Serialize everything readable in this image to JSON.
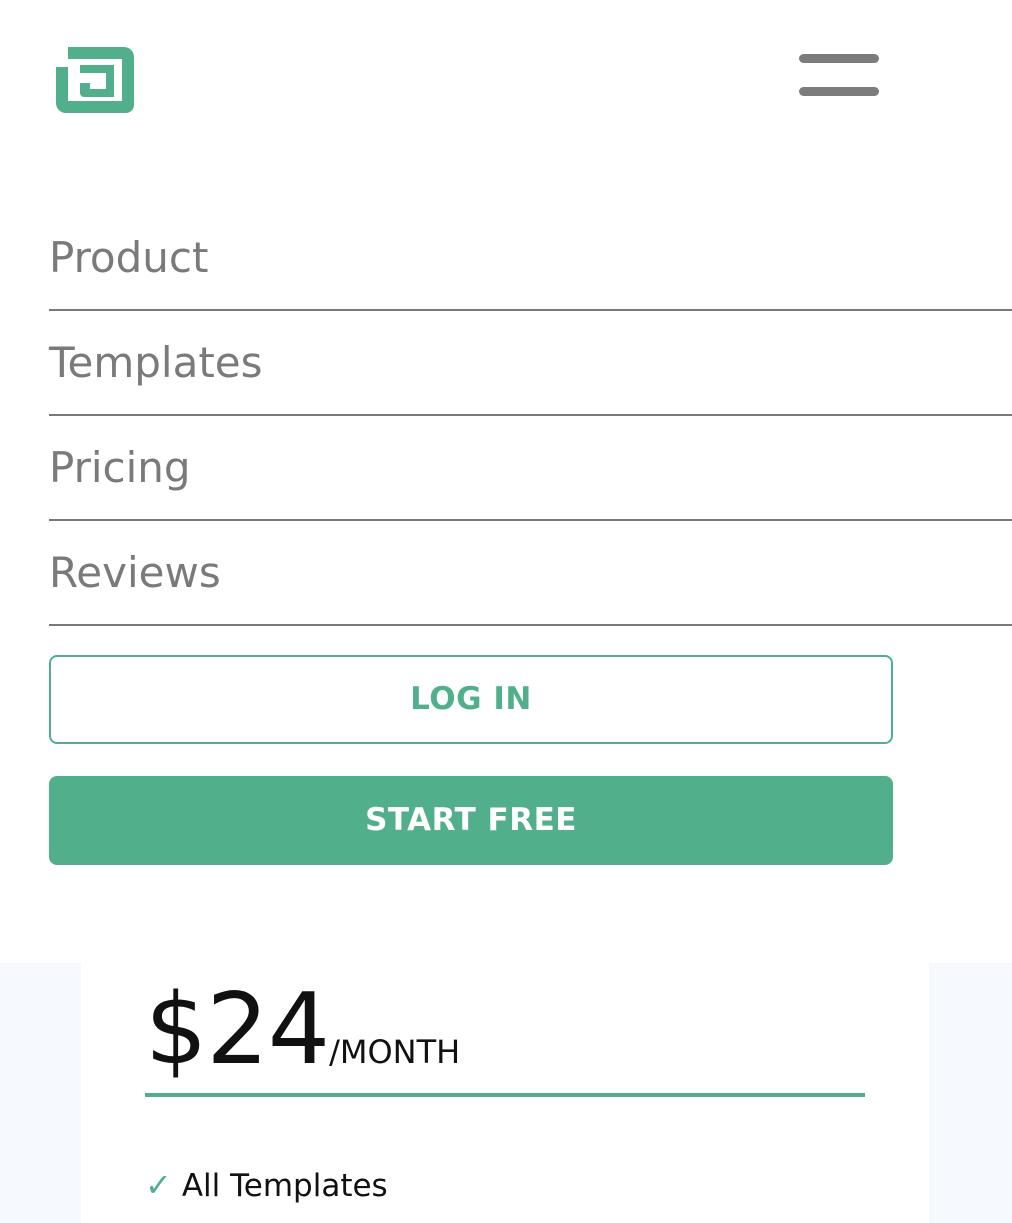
{
  "header": {
    "logo_icon": "logo-icon",
    "menu_icon": "hamburger-menu-icon"
  },
  "nav": {
    "items": [
      {
        "label": "Product"
      },
      {
        "label": "Templates"
      },
      {
        "label": "Pricing"
      },
      {
        "label": "Reviews"
      }
    ]
  },
  "actions": {
    "login_label": "LOG IN",
    "start_label": "START FREE"
  },
  "pricing": {
    "amount": "$24",
    "period": "/MONTH",
    "features": [
      {
        "icon": "check-icon",
        "label": "All Templates"
      }
    ]
  },
  "colors": {
    "accent": "#51b08b",
    "nav_text": "#7a7a7a",
    "pricing_background": "#f6f9fd"
  }
}
